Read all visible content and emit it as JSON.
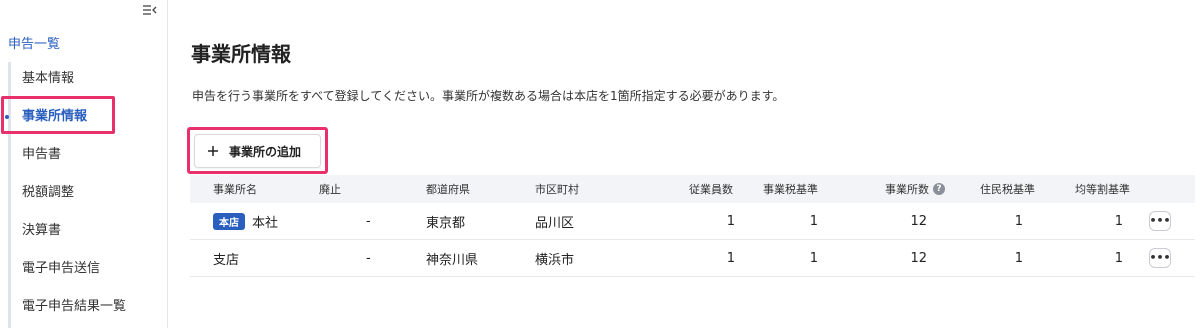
{
  "sidebar": {
    "collapse_icon": "collapse-menu-icon",
    "top_link": "申告一覧",
    "items": [
      {
        "label": "基本情報"
      },
      {
        "label": "事業所情報",
        "active": true
      },
      {
        "label": "申告書"
      },
      {
        "label": "税額調整"
      },
      {
        "label": "決算書"
      },
      {
        "label": "電子申告送信"
      },
      {
        "label": "電子申告結果一覧"
      }
    ]
  },
  "main": {
    "title": "事業所情報",
    "description": "申告を行う事業所をすべて登録してください。事業所が複数ある場合は本店を1箇所指定する必要があります。",
    "add_button": {
      "label": "事業所の追加",
      "icon": "plus-icon"
    }
  },
  "table": {
    "headers": {
      "name": "事業所名",
      "haishi": "廃止",
      "prefecture": "都道府県",
      "city": "市区町村",
      "employees": "従業員数",
      "business_tax_basis": "事業税基準",
      "office_count": "事業所数",
      "resident_tax_basis": "住民税基準",
      "equal_split_basis": "均等割基準"
    },
    "help_icon_text": "?",
    "rows": [
      {
        "badge": "本店",
        "name": "本社",
        "haishi": "-",
        "prefecture": "東京都",
        "city": "品川区",
        "employees": "1",
        "business_tax_basis": "1",
        "office_count": "12",
        "resident_tax_basis": "1",
        "equal_split_basis": "1",
        "more": "•••"
      },
      {
        "badge": "",
        "name": "支店",
        "haishi": "-",
        "prefecture": "神奈川県",
        "city": "横浜市",
        "employees": "1",
        "business_tax_basis": "1",
        "office_count": "12",
        "resident_tax_basis": "1",
        "equal_split_basis": "1",
        "more": "•••"
      }
    ]
  },
  "colors": {
    "accent": "#2a5fbf",
    "highlight": "#e8306a",
    "header_bg": "#f2f4f7"
  }
}
